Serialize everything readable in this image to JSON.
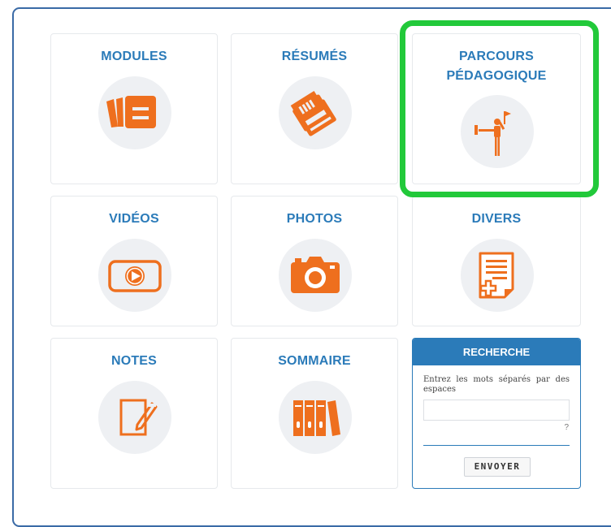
{
  "tiles": [
    {
      "title": "MODULES",
      "icon": "modules-icon"
    },
    {
      "title": "RÉSUMÉS",
      "icon": "summaries-icon"
    },
    {
      "title": "PARCOURS\nPÉDAGOGIQUE",
      "icon": "learning-path-icon"
    },
    {
      "title": "VIDÉOS",
      "icon": "video-icon"
    },
    {
      "title": "PHOTOS",
      "icon": "camera-icon"
    },
    {
      "title": "DIVERS",
      "icon": "document-plus-icon"
    },
    {
      "title": "NOTES",
      "icon": "note-edit-icon"
    },
    {
      "title": "SOMMAIRE",
      "icon": "binders-icon"
    }
  ],
  "search": {
    "title": "RECHERCHE",
    "hint": "Entrez les mots séparés par des espaces",
    "input_value": "",
    "help": "?",
    "submit_label": "ENVOYER"
  },
  "colors": {
    "accent": "#2b7bb9",
    "icon_orange": "#ee6f1e",
    "icon_bg": "#eef0f3",
    "highlight": "#22c93a",
    "frame_border": "#3a6aa6"
  }
}
